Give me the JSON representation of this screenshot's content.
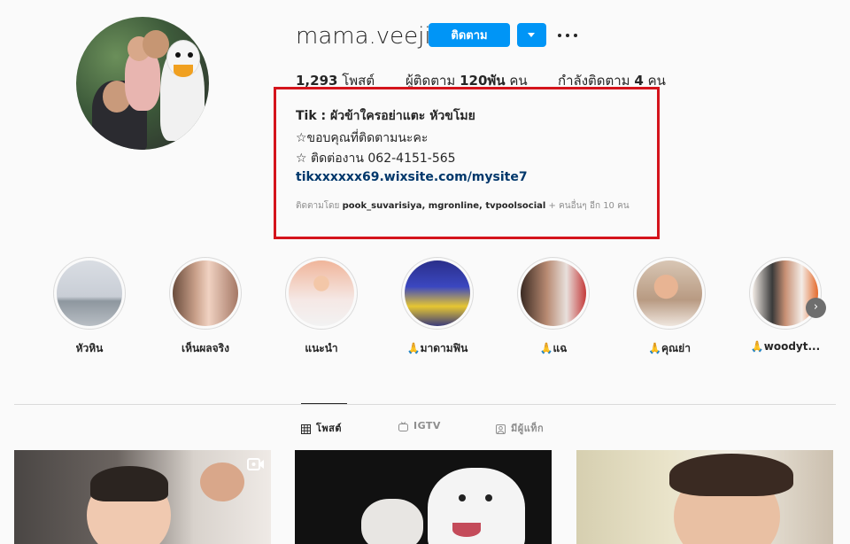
{
  "profile": {
    "username": "mama.veeji",
    "follow_label": "ติดตาม",
    "stats": {
      "posts": {
        "count": "1,293",
        "label": "โพสต์"
      },
      "followers": {
        "prefix": "ผู้ติดตาม",
        "count": "120พัน",
        "suffix": "คน"
      },
      "following": {
        "prefix": "กำลังติดตาม",
        "count": "4",
        "suffix": "คน"
      }
    }
  },
  "bio": {
    "name": "Tik : ผัวข้าใครอย่าแตะ หัวขโมย",
    "line1": "☆ขอบคุณที่ติดตามนะคะ",
    "line2": "☆ ติดต่องาน 062-4151-565",
    "link": "tikxxxxxx69.wixsite.com/mysite7",
    "followed_by_prefix": "ติดตามโดย",
    "followed_by_names": "pook_suvarisiya, mgronline, tvpoolsocial",
    "followed_by_suffix": "+ คนอื่นๆ อีก 10 คน"
  },
  "highlights": [
    {
      "label": "หัวหิน"
    },
    {
      "label": "เห็นผลจริง"
    },
    {
      "label": "แนะนำ"
    },
    {
      "label": "🙏มาดามฟิน"
    },
    {
      "label": "🙏แฉ"
    },
    {
      "label": "🙏คุณย่า"
    },
    {
      "label": "🙏woodyt..."
    }
  ],
  "tabs": [
    {
      "label": "โพสต์",
      "icon": "grid-icon"
    },
    {
      "label": "IGTV",
      "icon": "igtv-icon"
    },
    {
      "label": "มีผู้แท็ก",
      "icon": "tagged-icon"
    }
  ],
  "colors": {
    "accent": "#0095f6",
    "highlight_box": "#d4141c",
    "link": "#00376b"
  }
}
